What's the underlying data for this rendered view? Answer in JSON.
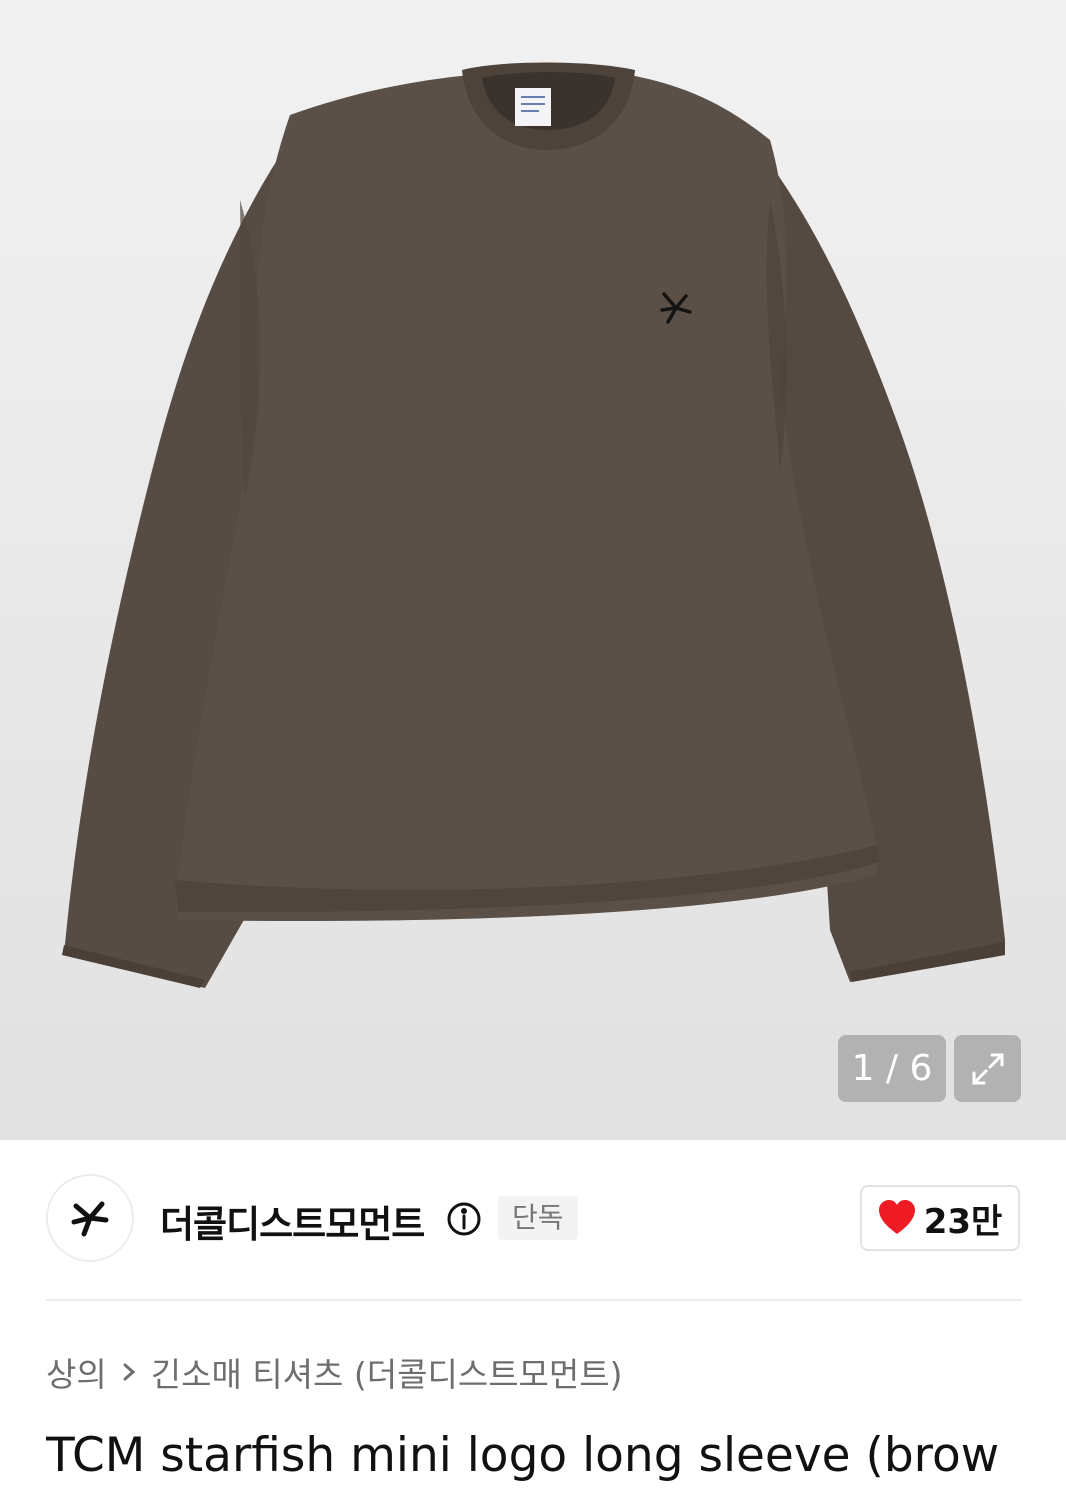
{
  "gallery": {
    "counter": "1 / 6",
    "product_color": "#5b5047"
  },
  "brand": {
    "name": "더콜디스트모먼트",
    "badge": "단독",
    "likes": "23만",
    "heart_color": "#ee1b24"
  },
  "breadcrumb": {
    "category": "상의",
    "subcategory": "긴소매 티셔츠 (더콜디스트모먼트)"
  },
  "product": {
    "title": "TCM starfish mini logo long sleeve (brow"
  }
}
